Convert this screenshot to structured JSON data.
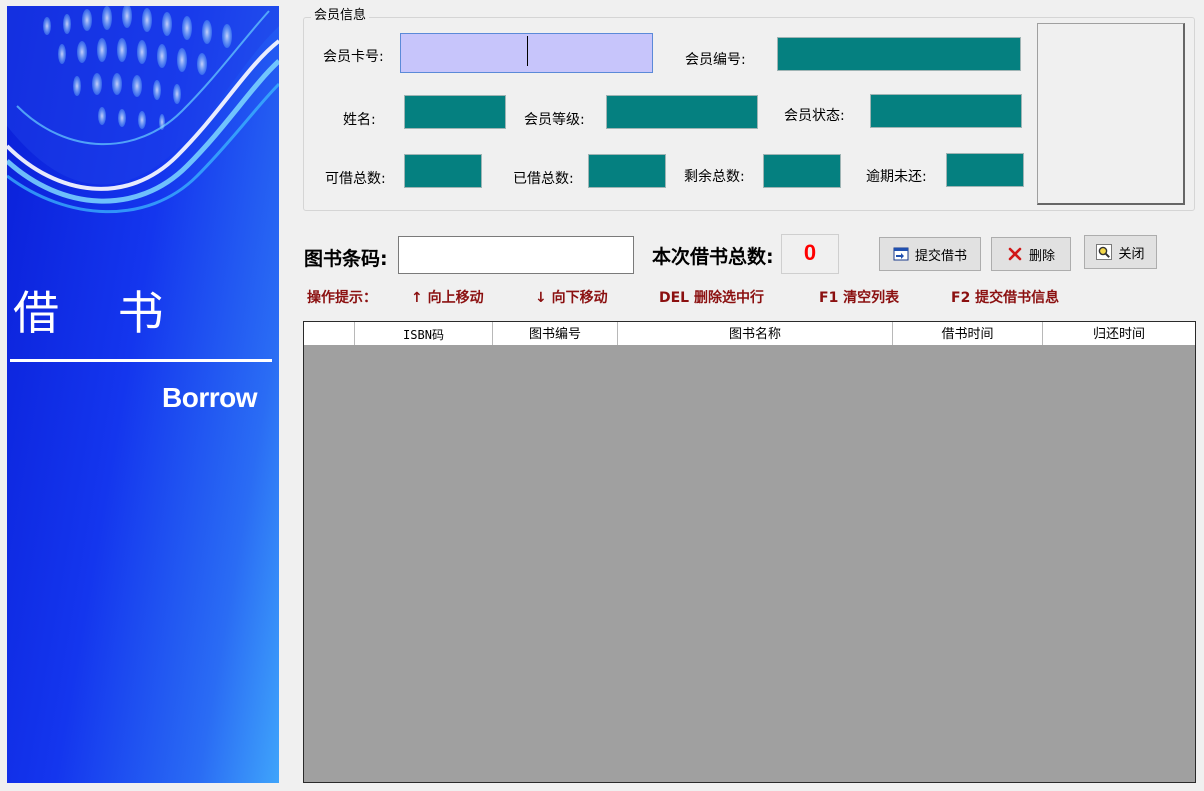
{
  "banner": {
    "title": "借 书",
    "subtitle": "Borrow"
  },
  "member": {
    "legend": "会员信息",
    "card_no_label": "会员卡号:",
    "card_no_value": "",
    "member_id_label": "会员编号:",
    "name_label": "姓名:",
    "level_label": "会员等级:",
    "status_label": "会员状态:",
    "borrowable_label": "可借总数:",
    "borrowed_label": "已借总数:",
    "remaining_label": "剩余总数:",
    "overdue_label": "逾期未还:"
  },
  "barcode": {
    "label": "图书条码:",
    "value": "",
    "count_label": "本次借书总数:",
    "count_value": "0"
  },
  "buttons": {
    "submit": "提交借书",
    "delete": "删除",
    "close": "关闭"
  },
  "hints": {
    "prefix": "操作提示：",
    "up": "↑ 向上移动",
    "down": "↓ 向下移动",
    "del": "DEL 删除选中行",
    "f1": "F1 清空列表",
    "f2": "F2 提交借书信息"
  },
  "grid": {
    "columns": [
      "",
      "ISBN码",
      "图书编号",
      "图书名称",
      "借书时间",
      "归还时间"
    ],
    "rows": []
  },
  "colors": {
    "banner_blue": "#1436ee",
    "readonly_teal": "#058080",
    "active_input": "#c7c5fb",
    "hint_red": "#8b1010",
    "count_red": "#ff0000",
    "grid_bg": "#a0a0a0"
  }
}
